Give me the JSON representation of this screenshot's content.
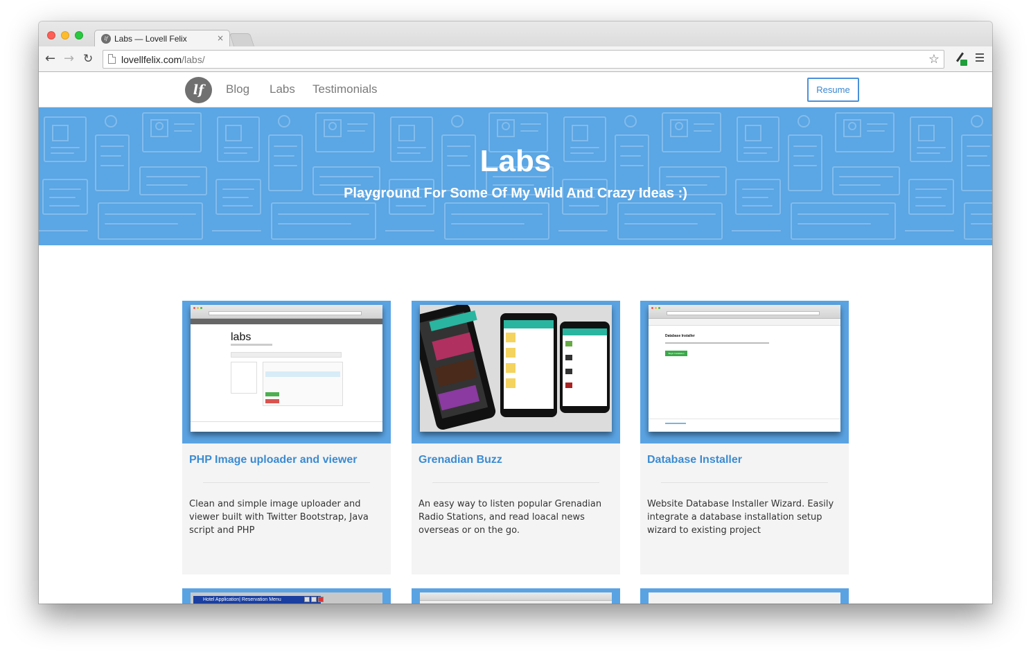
{
  "browser": {
    "tab_title": "Labs — Lovell Felix",
    "tab_favicon": "lf",
    "tab_close": "×",
    "url_host": "lovellfelix.com",
    "url_path": "/labs/",
    "icons": [
      "back-arrow-icon",
      "forward-arrow-icon",
      "reload-icon",
      "page-icon",
      "star-icon",
      "extension-icon",
      "menu-icon"
    ]
  },
  "site": {
    "logo_text": "lf",
    "nav": {
      "blog": "Blog",
      "labs": "Labs",
      "testimonials": "Testimonials",
      "resume": "Resume"
    },
    "hero": {
      "title": "Labs",
      "subtitle": "Playground For Some Of My Wild And Crazy Ideas :)",
      "background_color": "#5ba6e4"
    },
    "accent_color": "#3b8bd1",
    "projects": [
      {
        "title": "PHP Image uploader and viewer",
        "description": "Clean and simple image uploader and viewer built with Twitter Bootstrap, Java script and PHP",
        "thumb_heading": "labs"
      },
      {
        "title": "Grenadian Buzz",
        "description": "An easy way to listen popular Grenadian Radio Stations, and read loacal news overseas or on the go."
      },
      {
        "title": "Database Installer",
        "description": "Website Database Installer Wizard. Easily integrate a database installation setup wizard to existing project",
        "thumb_heading": "Database Installer",
        "thumb_button": "Begin Installation"
      }
    ],
    "peek_thumbs": [
      {
        "caption": "Hotel Application| Reservation Menu"
      },
      {
        "caption": ""
      },
      {
        "caption": ""
      }
    ]
  }
}
